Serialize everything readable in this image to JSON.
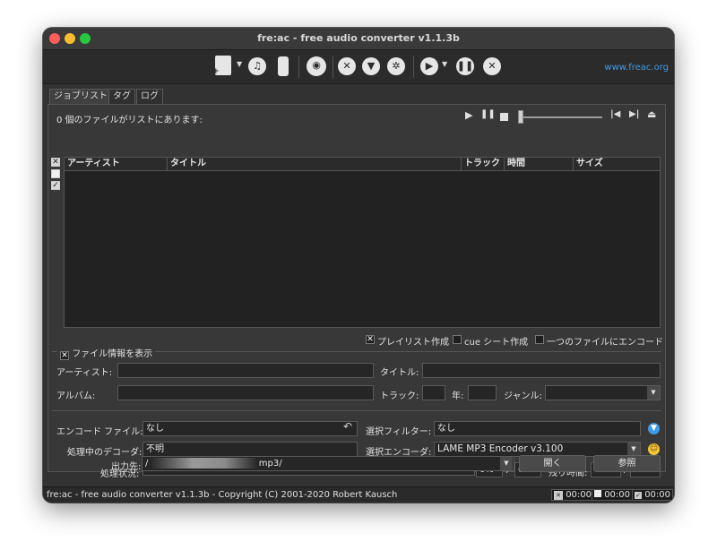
{
  "window": {
    "title": "fre:ac - free audio converter v1.1.3b"
  },
  "traffic_lights": {
    "close_color": "#ff5f57",
    "minimize_color": "#febc2e",
    "zoom_color": "#28c840"
  },
  "toolbar": {
    "link": "www.freac.org",
    "icons": [
      "add-files-icon",
      "add-cd-icon",
      "add-folder-icon",
      "cddb-query-icon",
      "settings-icon",
      "filter-icon",
      "config-icon",
      "play-icon",
      "pause-icon",
      "stop-icon"
    ]
  },
  "tabs": [
    "ジョブリスト",
    "タグ",
    "ログ"
  ],
  "joblist": {
    "status_text": "0 個のファイルがリストにあります:",
    "columns": [
      "アーティスト",
      "タイトル",
      "トラック",
      "時間",
      "サイズ"
    ],
    "rows": []
  },
  "options": {
    "playlist_label": "プレイリスト作成",
    "playlist_checked": true,
    "cue_label": "cue シート作成",
    "cue_checked": false,
    "single_file_label": "一つのファイルにエンコード",
    "single_file_checked": false
  },
  "info": {
    "toggle_label": "ファイル情報を表示",
    "toggle_checked": true,
    "artist_label": "アーティスト:",
    "title_label": "タイトル:",
    "album_label": "アルバム:",
    "track_label": "トラック:",
    "year_label": "年:",
    "genre_label": "ジャンル:"
  },
  "encode": {
    "file_label": "エンコード ファイル:",
    "file_value": "なし",
    "filter_label": "選択フィルター:",
    "filter_value": "なし",
    "decoder_label": "処理中のデコーダ:",
    "decoder_value": "不明",
    "encoder_label": "選択エンコーダ:",
    "encoder_value": "LAME MP3 Encoder v3.100",
    "progress_label": "処理状況:",
    "progress_file_pct": "0%",
    "progress_total_pct": "0%",
    "progress_separator": "/",
    "time_left_label": "残り時間:",
    "time_left": "00:00",
    "time_total": "00:00",
    "output_label": "出力先:",
    "output_prefix": "/",
    "output_suffix": "mp3/",
    "open_button": "開く",
    "browse_button": "参照"
  },
  "statusbar": {
    "text": "fre:ac - free audio converter v1.1.3b - Copyright (C) 2001-2020 Robert Kausch",
    "times": [
      "00:00",
      "00:00",
      "00:00"
    ]
  }
}
